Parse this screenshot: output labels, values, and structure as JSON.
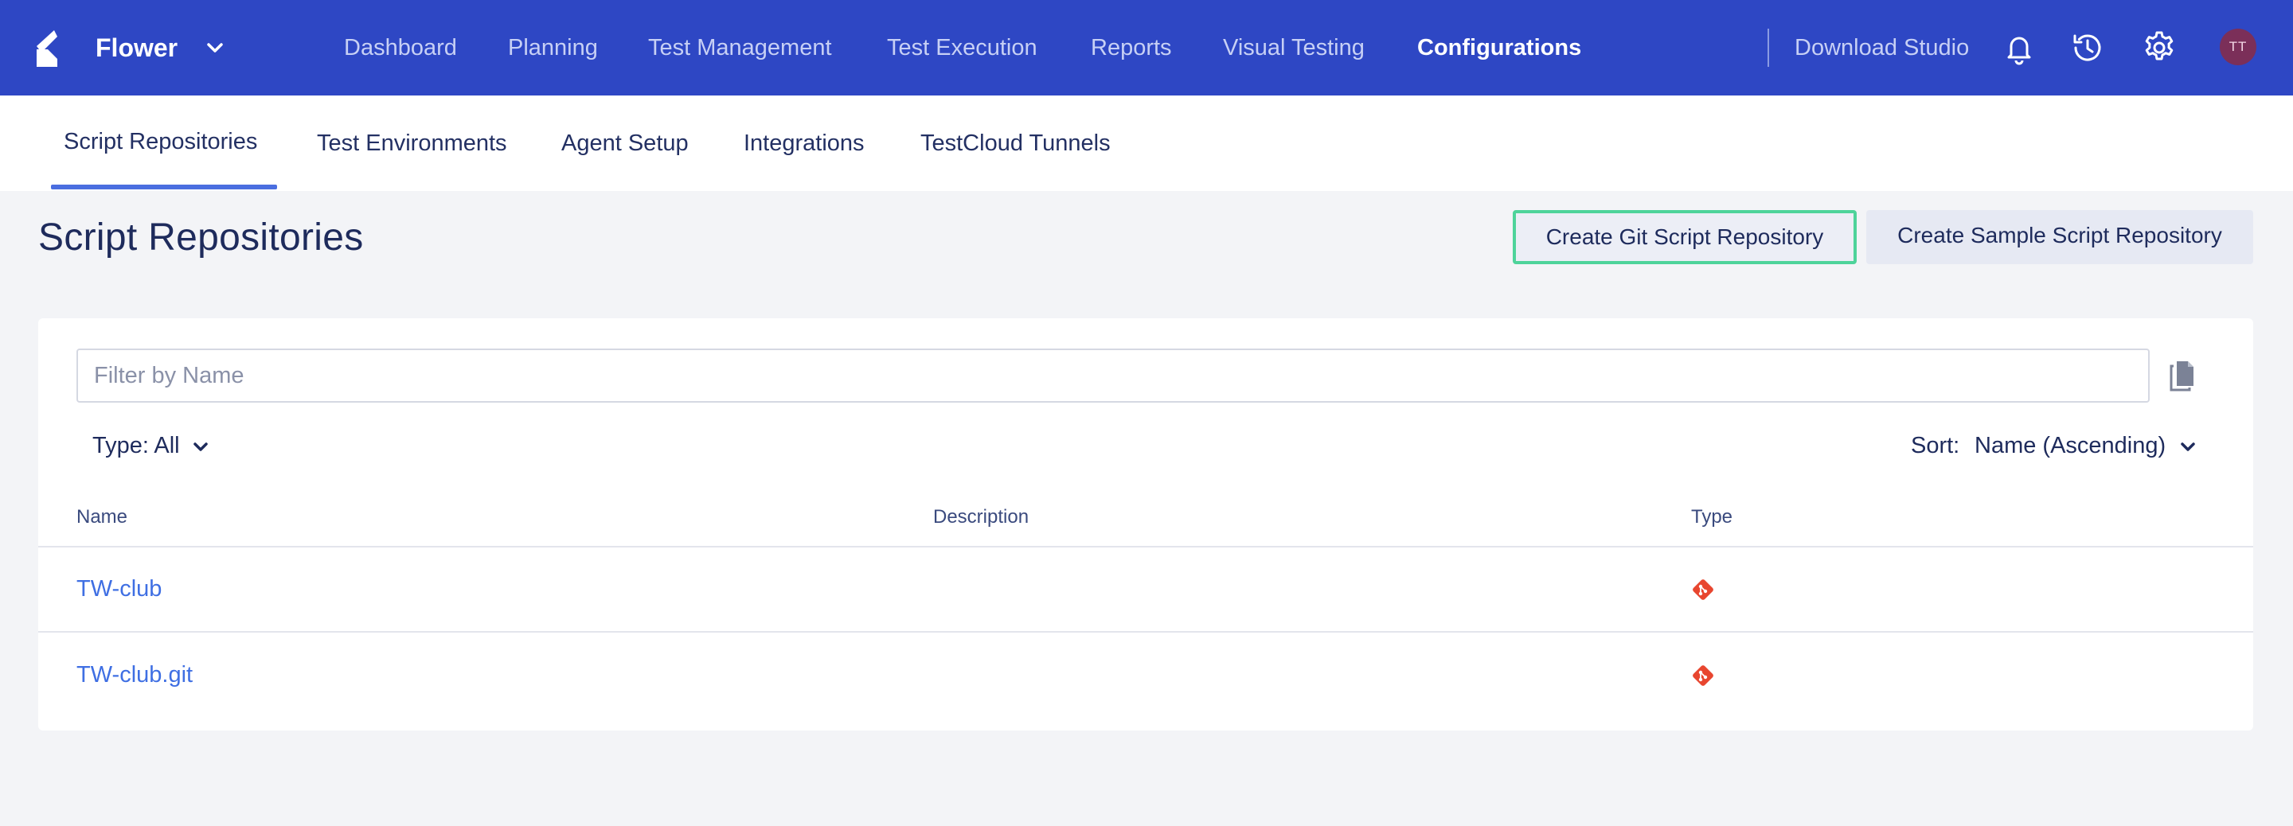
{
  "app": {
    "brand": "Flower",
    "logo_icon": "flower-logo-icon"
  },
  "topnav": {
    "items": [
      {
        "label": "Dashboard",
        "active": false
      },
      {
        "label": "Planning",
        "active": false
      },
      {
        "label": "Test Management",
        "active": false
      },
      {
        "label": "Test Execution",
        "active": false
      },
      {
        "label": "Reports",
        "active": false
      },
      {
        "label": "Visual Testing",
        "active": false
      },
      {
        "label": "Configurations",
        "active": true
      }
    ],
    "download": "Download Studio",
    "icons": [
      "bell-icon",
      "history-icon",
      "gear-icon"
    ],
    "avatar_initials": "TT"
  },
  "subtabs": {
    "items": [
      {
        "label": "Script Repositories",
        "active": true
      },
      {
        "label": "Test Environments",
        "active": false
      },
      {
        "label": "Agent Setup",
        "active": false
      },
      {
        "label": "Integrations",
        "active": false
      },
      {
        "label": "TestCloud Tunnels",
        "active": false
      }
    ]
  },
  "page": {
    "title": "Script Repositories",
    "create_git_label": "Create Git Script Repository",
    "create_sample_label": "Create Sample Script Repository"
  },
  "filters": {
    "name_placeholder": "Filter by Name",
    "name_value": "",
    "type_label": "Type: All",
    "sort_label": "Sort:",
    "sort_value": "Name (Ascending)"
  },
  "table": {
    "columns": [
      "Name",
      "Description",
      "Type"
    ],
    "rows": [
      {
        "name": "TW-club",
        "description": "",
        "type_icon": "git-icon"
      },
      {
        "name": "TW-club.git",
        "description": "",
        "type_icon": "git-icon"
      }
    ]
  },
  "colors": {
    "nav_bg": "#2e47c4",
    "accent": "#4a6ee0",
    "link": "#3f6fe3",
    "git": "#e8462f",
    "highlight_border": "#4ed39a",
    "avatar_bg": "#7b2f59"
  }
}
